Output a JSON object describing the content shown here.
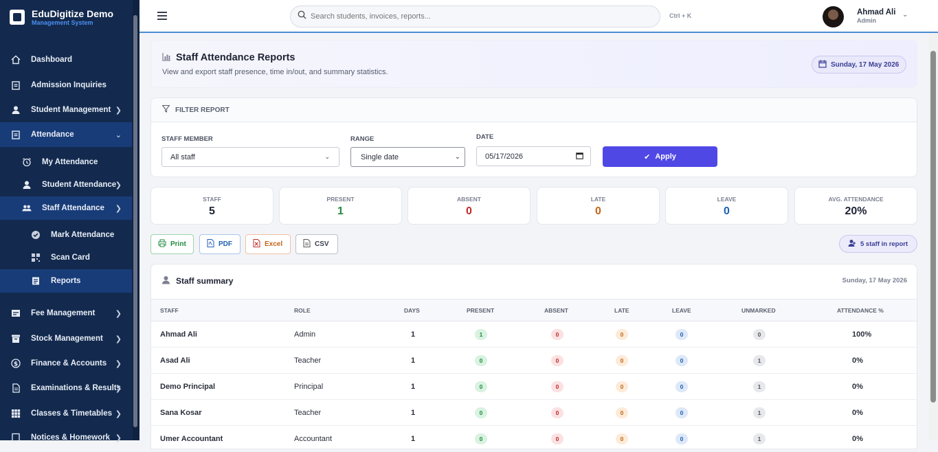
{
  "brand": {
    "name": "EduDigitize Demo",
    "sub": "Management System"
  },
  "sidebar": {
    "items": [
      {
        "label": "Dashboard"
      },
      {
        "label": "Admission Inquiries"
      },
      {
        "label": "Student Management"
      },
      {
        "label": "Attendance"
      },
      {
        "label": "My Attendance"
      },
      {
        "label": "Student Attendance"
      },
      {
        "label": "Staff Attendance"
      },
      {
        "label": "Mark Attendance"
      },
      {
        "label": "Scan Card"
      },
      {
        "label": "Reports"
      },
      {
        "label": "Fee Management"
      },
      {
        "label": "Stock Management"
      },
      {
        "label": "Finance & Accounts"
      },
      {
        "label": "Examinations & Results"
      },
      {
        "label": "Classes & Timetables"
      },
      {
        "label": "Notices & Homework"
      }
    ]
  },
  "topbar": {
    "search_placeholder": "Search students, invoices, reports...",
    "shortcut": "Ctrl + K",
    "user_name": "Ahmad Ali",
    "user_role": "Admin"
  },
  "header": {
    "title": "Staff Attendance Reports",
    "subtitle": "View and export staff presence, time in/out, and summary statistics.",
    "date": "Sunday, 17 May 2026"
  },
  "filter": {
    "heading": "FILTER REPORT",
    "staff_label": "STAFF MEMBER",
    "staff_value": "All staff",
    "range_label": "RANGE",
    "range_value": "Single date",
    "date_label": "DATE",
    "date_value": "05/17/2026",
    "apply_label": "Apply"
  },
  "stats": [
    {
      "label": "STAFF",
      "value": "5",
      "color": "#1e2233"
    },
    {
      "label": "PRESENT",
      "value": "1",
      "color": "#1f8a3e"
    },
    {
      "label": "ABSENT",
      "value": "0",
      "color": "#c02a2a"
    },
    {
      "label": "LATE",
      "value": "0",
      "color": "#c0661a"
    },
    {
      "label": "LEAVE",
      "value": "0",
      "color": "#1e5fb3"
    },
    {
      "label": "AVG. ATTENDANCE",
      "value": "20%",
      "color": "#1e2233"
    }
  ],
  "exports": {
    "print": "Print",
    "pdf": "PDF",
    "excel": "Excel",
    "csv": "CSV",
    "count": "5 staff in report"
  },
  "summary": {
    "title": "Staff summary",
    "date": "Sunday, 17 May 2026",
    "columns": [
      "STAFF",
      "ROLE",
      "DAYS",
      "PRESENT",
      "ABSENT",
      "LATE",
      "LEAVE",
      "UNMARKED",
      "ATTENDANCE %"
    ],
    "rows": [
      {
        "staff": "Ahmad Ali",
        "role": "Admin",
        "days": "1",
        "present": "1",
        "absent": "0",
        "late": "0",
        "leave": "0",
        "unmarked": "0",
        "pct": "100%"
      },
      {
        "staff": "Asad Ali",
        "role": "Teacher",
        "days": "1",
        "present": "0",
        "absent": "0",
        "late": "0",
        "leave": "0",
        "unmarked": "1",
        "pct": "0%"
      },
      {
        "staff": "Demo Principal",
        "role": "Principal",
        "days": "1",
        "present": "0",
        "absent": "0",
        "late": "0",
        "leave": "0",
        "unmarked": "1",
        "pct": "0%"
      },
      {
        "staff": "Sana Kosar",
        "role": "Teacher",
        "days": "1",
        "present": "0",
        "absent": "0",
        "late": "0",
        "leave": "0",
        "unmarked": "1",
        "pct": "0%"
      },
      {
        "staff": "Umer Accountant",
        "role": "Accountant",
        "days": "1",
        "present": "0",
        "absent": "0",
        "late": "0",
        "leave": "0",
        "unmarked": "1",
        "pct": "0%"
      }
    ]
  }
}
